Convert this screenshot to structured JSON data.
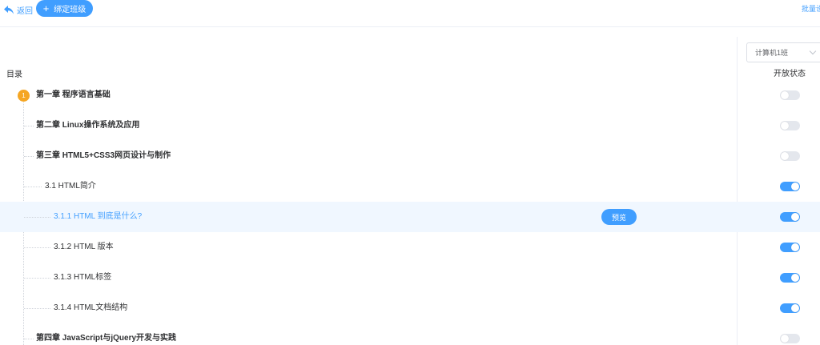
{
  "header": {
    "back_label": "返回",
    "bind_class_label": "绑定班级",
    "batch_label": "批量设置"
  },
  "status_panel": {
    "class_select_value": "计算机1班",
    "column_header": "开放状态"
  },
  "catalog": {
    "title": "目录",
    "badge_number": "1",
    "preview_label": "预览",
    "rows": [
      {
        "text": "第一章 程序语言基础",
        "level": "chapter",
        "open": false
      },
      {
        "text": "第二章 Linux操作系统及应用",
        "level": "chapter",
        "open": false
      },
      {
        "text": "第三章 HTML5+CSS3网页设计与制作",
        "level": "chapter",
        "open": false
      },
      {
        "text": "3.1 HTML简介",
        "level": "section",
        "open": true
      },
      {
        "text": "3.1.1 HTML 到底是什么?",
        "level": "subsection",
        "open": true,
        "selected": true
      },
      {
        "text": "3.1.2 HTML 版本",
        "level": "subsection",
        "open": true
      },
      {
        "text": "3.1.3 HTML标签",
        "level": "subsection",
        "open": true
      },
      {
        "text": "3.1.4 HTML文档结构",
        "level": "subsection",
        "open": true
      },
      {
        "text": "第四章 JavaScript与jQuery开发与实践",
        "level": "chapter",
        "open": false
      }
    ]
  },
  "colors": {
    "accent": "#409eff",
    "badge": "#f5a623",
    "switch_off": "#e4e7ed",
    "selected_row": "#f0f7ff"
  }
}
